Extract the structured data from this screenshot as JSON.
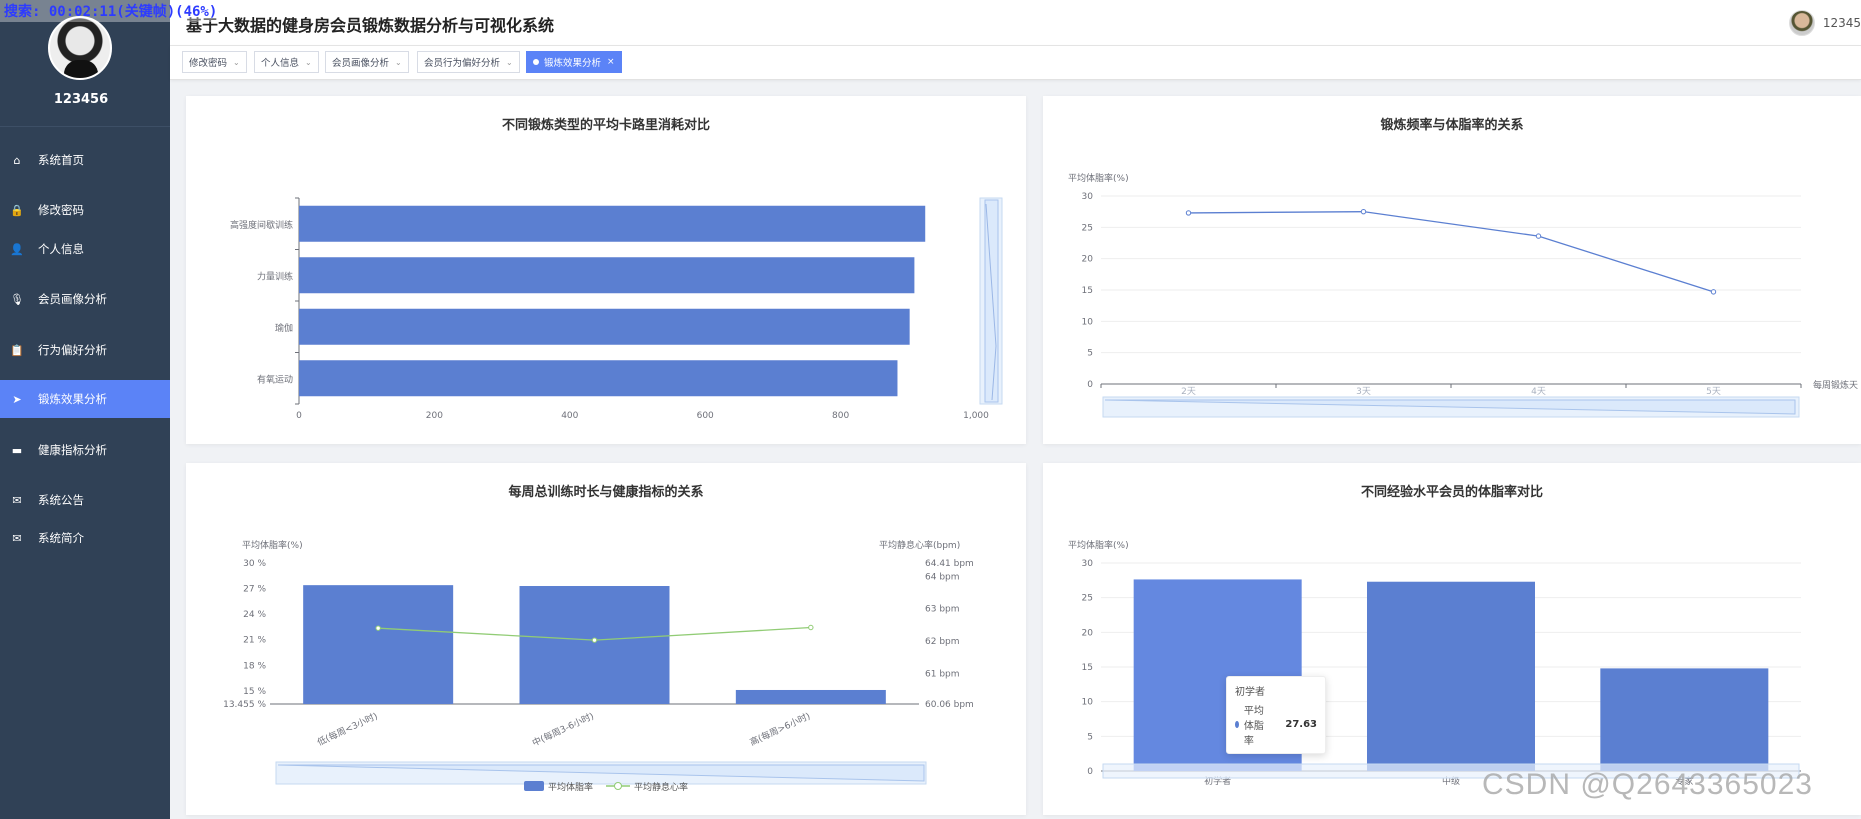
{
  "recorder": {
    "text": "搜索: 00:02:11(关键帧)(46%)"
  },
  "sidebar": {
    "username": "123456",
    "items": [
      {
        "label": "系统首页",
        "icon": "home-icon",
        "glyph": "⌂"
      },
      {
        "label": "修改密码",
        "icon": "lock-icon",
        "glyph": "🔒"
      },
      {
        "label": "个人信息",
        "icon": "user-icon",
        "glyph": "👤"
      },
      {
        "label": "会员画像分析",
        "icon": "microphone-icon",
        "glyph": "🎙"
      },
      {
        "label": "行为偏好分析",
        "icon": "clipboard-icon",
        "glyph": "📋"
      },
      {
        "label": "锻炼效果分析",
        "icon": "send-icon",
        "glyph": "➤"
      },
      {
        "label": "健康指标分析",
        "icon": "monitor-icon",
        "glyph": "▬"
      },
      {
        "label": "系统公告",
        "icon": "mail-icon",
        "glyph": "✉"
      },
      {
        "label": "系统简介",
        "icon": "mail-icon",
        "glyph": "✉"
      }
    ],
    "active_index": 5
  },
  "header": {
    "title": "基于大数据的健身房会员锻炼数据分析与可视化系统",
    "user": "12345"
  },
  "tabs": [
    {
      "label": "修改密码",
      "active": false
    },
    {
      "label": "个人信息",
      "active": false
    },
    {
      "label": "会员画像分析",
      "active": false
    },
    {
      "label": "会员行为偏好分析",
      "active": false
    },
    {
      "label": "锻炼效果分析",
      "active": true,
      "close": "×"
    }
  ],
  "charts": {
    "calorie": {
      "title": "不同锻炼类型的平均卡路里消耗对比"
    },
    "frequency": {
      "title": "锻炼频率与体脂率的关系"
    },
    "training": {
      "title": "每周总训练时长与健康指标的关系"
    },
    "experience": {
      "title": "不同经验水平会员的体脂率对比"
    }
  },
  "chart_data": [
    {
      "type": "bar",
      "orientation": "horizontal",
      "title": "不同锻炼类型的平均卡路里消耗对比",
      "categories": [
        "高强度间歇训练",
        "力量训练",
        "瑜伽",
        "有氧运动"
      ],
      "values": [
        925,
        909,
        902,
        884
      ],
      "xlim": [
        0,
        1000
      ],
      "xticks": [
        "0",
        "200",
        "400",
        "600",
        "800",
        "1,000"
      ],
      "color": "#5b7fd1",
      "datazoom": "right"
    },
    {
      "type": "line",
      "title": "锻炼频率与体脂率的关系",
      "ylabel": "平均体脂率(%)",
      "xlabel": "每周锻炼天",
      "categories": [
        "2天",
        "3天",
        "4天",
        "5天"
      ],
      "values": [
        27.3,
        27.5,
        23.6,
        14.7
      ],
      "ylim": [
        0,
        30
      ],
      "yticks": [
        "0",
        "5",
        "10",
        "15",
        "20",
        "25",
        "30"
      ],
      "color": "#5b7fd1",
      "datazoom": "bottom"
    },
    {
      "type": "bar",
      "title": "每周总训练时长与健康指标的关系",
      "categories": [
        "低(每周<3小时)",
        "中(每周3-6小时)",
        "高(每周>6小时)"
      ],
      "series": [
        {
          "name": "平均体脂率",
          "type": "bar",
          "values": [
            27.4,
            27.3,
            15.1
          ],
          "color": "#5b7fd1"
        },
        {
          "name": "平均静息心率",
          "type": "line",
          "values": [
            62.4,
            62.03,
            62.42
          ],
          "color": "#91cc75"
        }
      ],
      "ylabel_left": "平均体脂率(%)",
      "ylabel_right": "平均静息心率(bpm)",
      "ylim_left": [
        13.455,
        30
      ],
      "ylim_right": [
        60.06,
        64.41
      ],
      "yticks_left": [
        "13.455 %",
        "15 %",
        "18 %",
        "21 %",
        "24 %",
        "27 %",
        "30 %"
      ],
      "yticks_right": [
        "60.06 bpm",
        "61 bpm",
        "62 bpm",
        "63 bpm",
        "64 bpm",
        "64.41 bpm"
      ],
      "legend": "bottom"
    },
    {
      "type": "bar",
      "title": "不同经验水平会员的体脂率对比",
      "ylabel": "平均体脂率(%)",
      "categories": [
        "初学者",
        "中级",
        "专家"
      ],
      "values": [
        27.63,
        27.3,
        14.8
      ],
      "ylim": [
        0,
        30
      ],
      "yticks": [
        "0",
        "5",
        "10",
        "15",
        "20",
        "25",
        "30"
      ],
      "color": "#5b7fd1",
      "tooltip": {
        "category": "初学者",
        "series": "平均体脂率",
        "value": "27.63"
      }
    }
  ],
  "watermark": "CSDN @Q2643365023"
}
